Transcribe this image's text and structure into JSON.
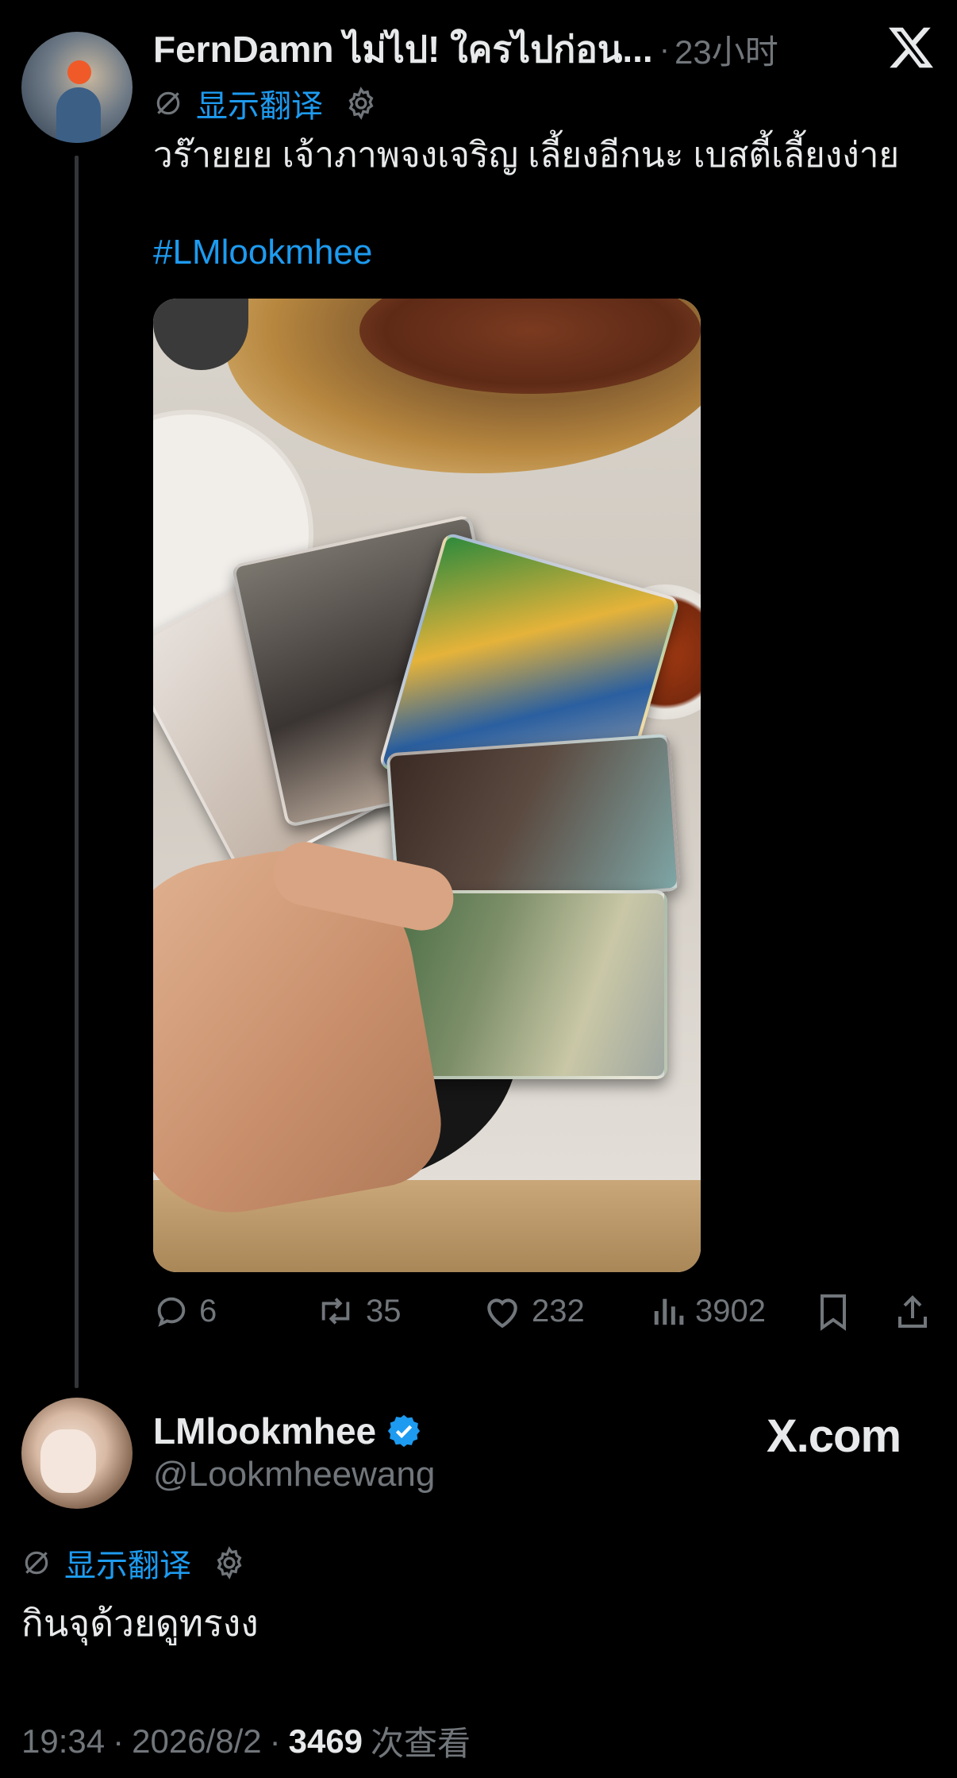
{
  "tweet": {
    "display_name": "FernDamn ไม่ไป! ใครไปก่อน...",
    "separator": "·",
    "time_ago": "23小时",
    "translate_label": "显示翻译",
    "text": "วร๊ายยย เจ้าภาพจงเจริญ เลี้ยงอีกนะ เบสตี้เลี้ยงง่าย",
    "hashtag": "#LMlookmhee",
    "replies": "6",
    "retweets": "35",
    "likes": "232",
    "views": "3902"
  },
  "quoted": {
    "display_name": "LMlookmhee",
    "handle": "@Lookmheewang",
    "translate_label": "显示翻译",
    "text": "กินจุด้วยดูทรงง",
    "time": "19:34",
    "sep1": "·",
    "date": "2026/8/2",
    "sep2": "·",
    "view_count": "3469",
    "view_label": "次查看"
  },
  "brand": {
    "watermark": "X.com"
  },
  "colors": {
    "background": "#000000",
    "text": "#e7e9ea",
    "muted": "#71767b",
    "accent": "#1d9bf0",
    "verified": "#1d9bf0"
  },
  "icons": [
    "x-logo-icon",
    "translate-off-icon",
    "gear-icon",
    "reply-icon",
    "retweet-icon",
    "like-icon",
    "views-icon",
    "bookmark-icon",
    "share-icon",
    "verified-badge-icon"
  ]
}
